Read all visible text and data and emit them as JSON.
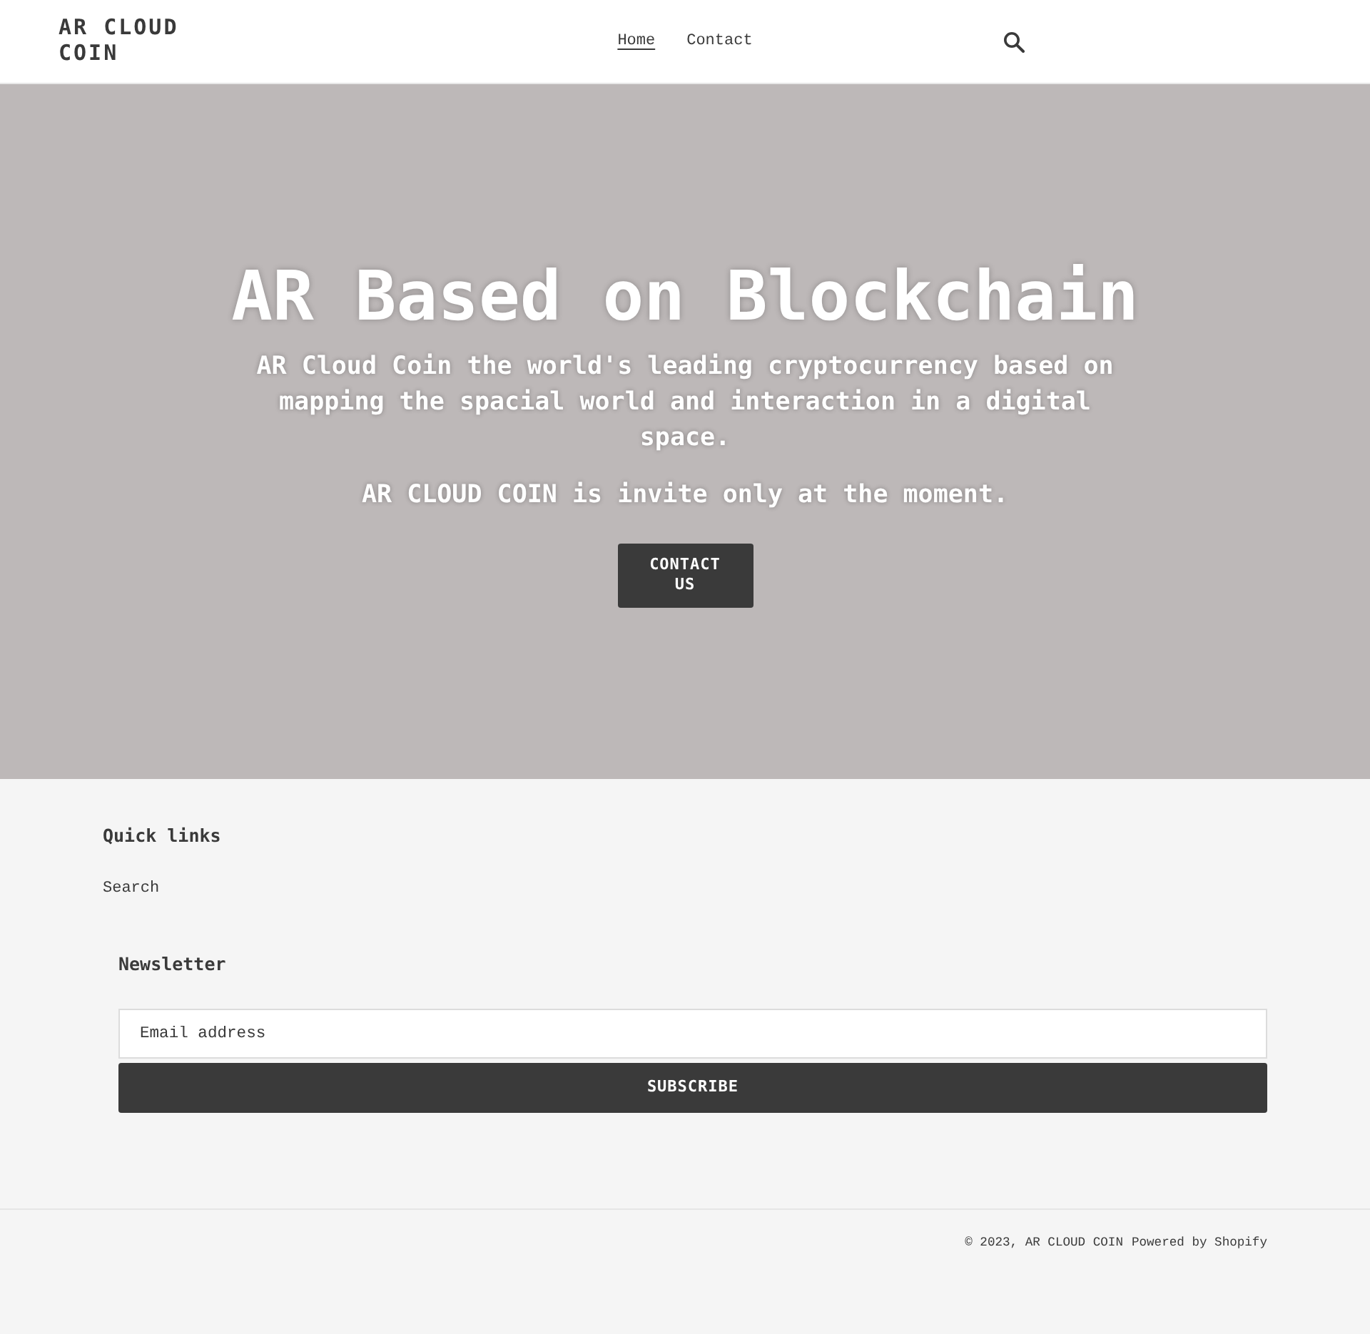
{
  "header": {
    "logo": "AR CLOUD COIN",
    "nav": [
      {
        "label": "Home",
        "selected": true
      },
      {
        "label": "Contact",
        "selected": false
      }
    ]
  },
  "hero": {
    "title": "AR Based on Blockchain",
    "paragraphs": [
      "AR Cloud Coin the world's leading cryptocurrency based on mapping the spacial world and interaction in a digital space.",
      "AR CLOUD COIN is invite only at the moment."
    ],
    "button": "CONTACT US"
  },
  "footer": {
    "quick_links": {
      "heading": "Quick links",
      "links": [
        "Search"
      ]
    },
    "newsletter": {
      "heading": "Newsletter",
      "placeholder": "Email address",
      "button": "SUBSCRIBE"
    },
    "copyright": "© 2023, AR CLOUD COIN",
    "powered_by": "Powered by Shopify"
  }
}
